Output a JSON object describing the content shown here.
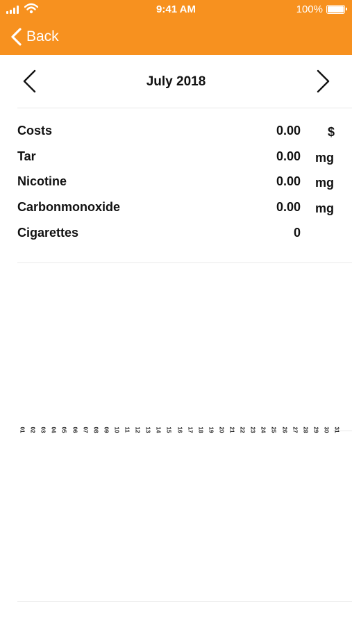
{
  "status_bar": {
    "time": "9:41 AM",
    "battery": "100%"
  },
  "nav": {
    "back_label": "Back"
  },
  "month": {
    "title": "July 2018"
  },
  "stats": [
    {
      "label": "Costs",
      "value": "0.00",
      "unit": "$"
    },
    {
      "label": "Tar",
      "value": "0.00",
      "unit": "mg"
    },
    {
      "label": "Nicotine",
      "value": "0.00",
      "unit": "mg"
    },
    {
      "label": "Carbonmonoxide",
      "value": "0.00",
      "unit": "mg"
    },
    {
      "label": "Cigarettes",
      "value": "0",
      "unit": ""
    }
  ],
  "chart_data": {
    "type": "bar",
    "categories": [
      "01",
      "02",
      "03",
      "04",
      "05",
      "06",
      "07",
      "08",
      "09",
      "10",
      "11",
      "12",
      "13",
      "14",
      "15",
      "16",
      "17",
      "18",
      "19",
      "20",
      "21",
      "22",
      "23",
      "24",
      "25",
      "26",
      "27",
      "28",
      "29",
      "30",
      "31"
    ],
    "values": [
      0,
      0,
      0,
      0,
      0,
      0,
      0,
      0,
      0,
      0,
      0,
      0,
      0,
      0,
      0,
      0,
      0,
      0,
      0,
      0,
      0,
      0,
      0,
      0,
      0,
      0,
      0,
      0,
      0,
      0,
      0
    ],
    "title": "",
    "xlabel": "",
    "ylabel": ""
  },
  "colors": {
    "header": "#f7911f",
    "text": "#111111",
    "divider": "#e8e8e8"
  }
}
